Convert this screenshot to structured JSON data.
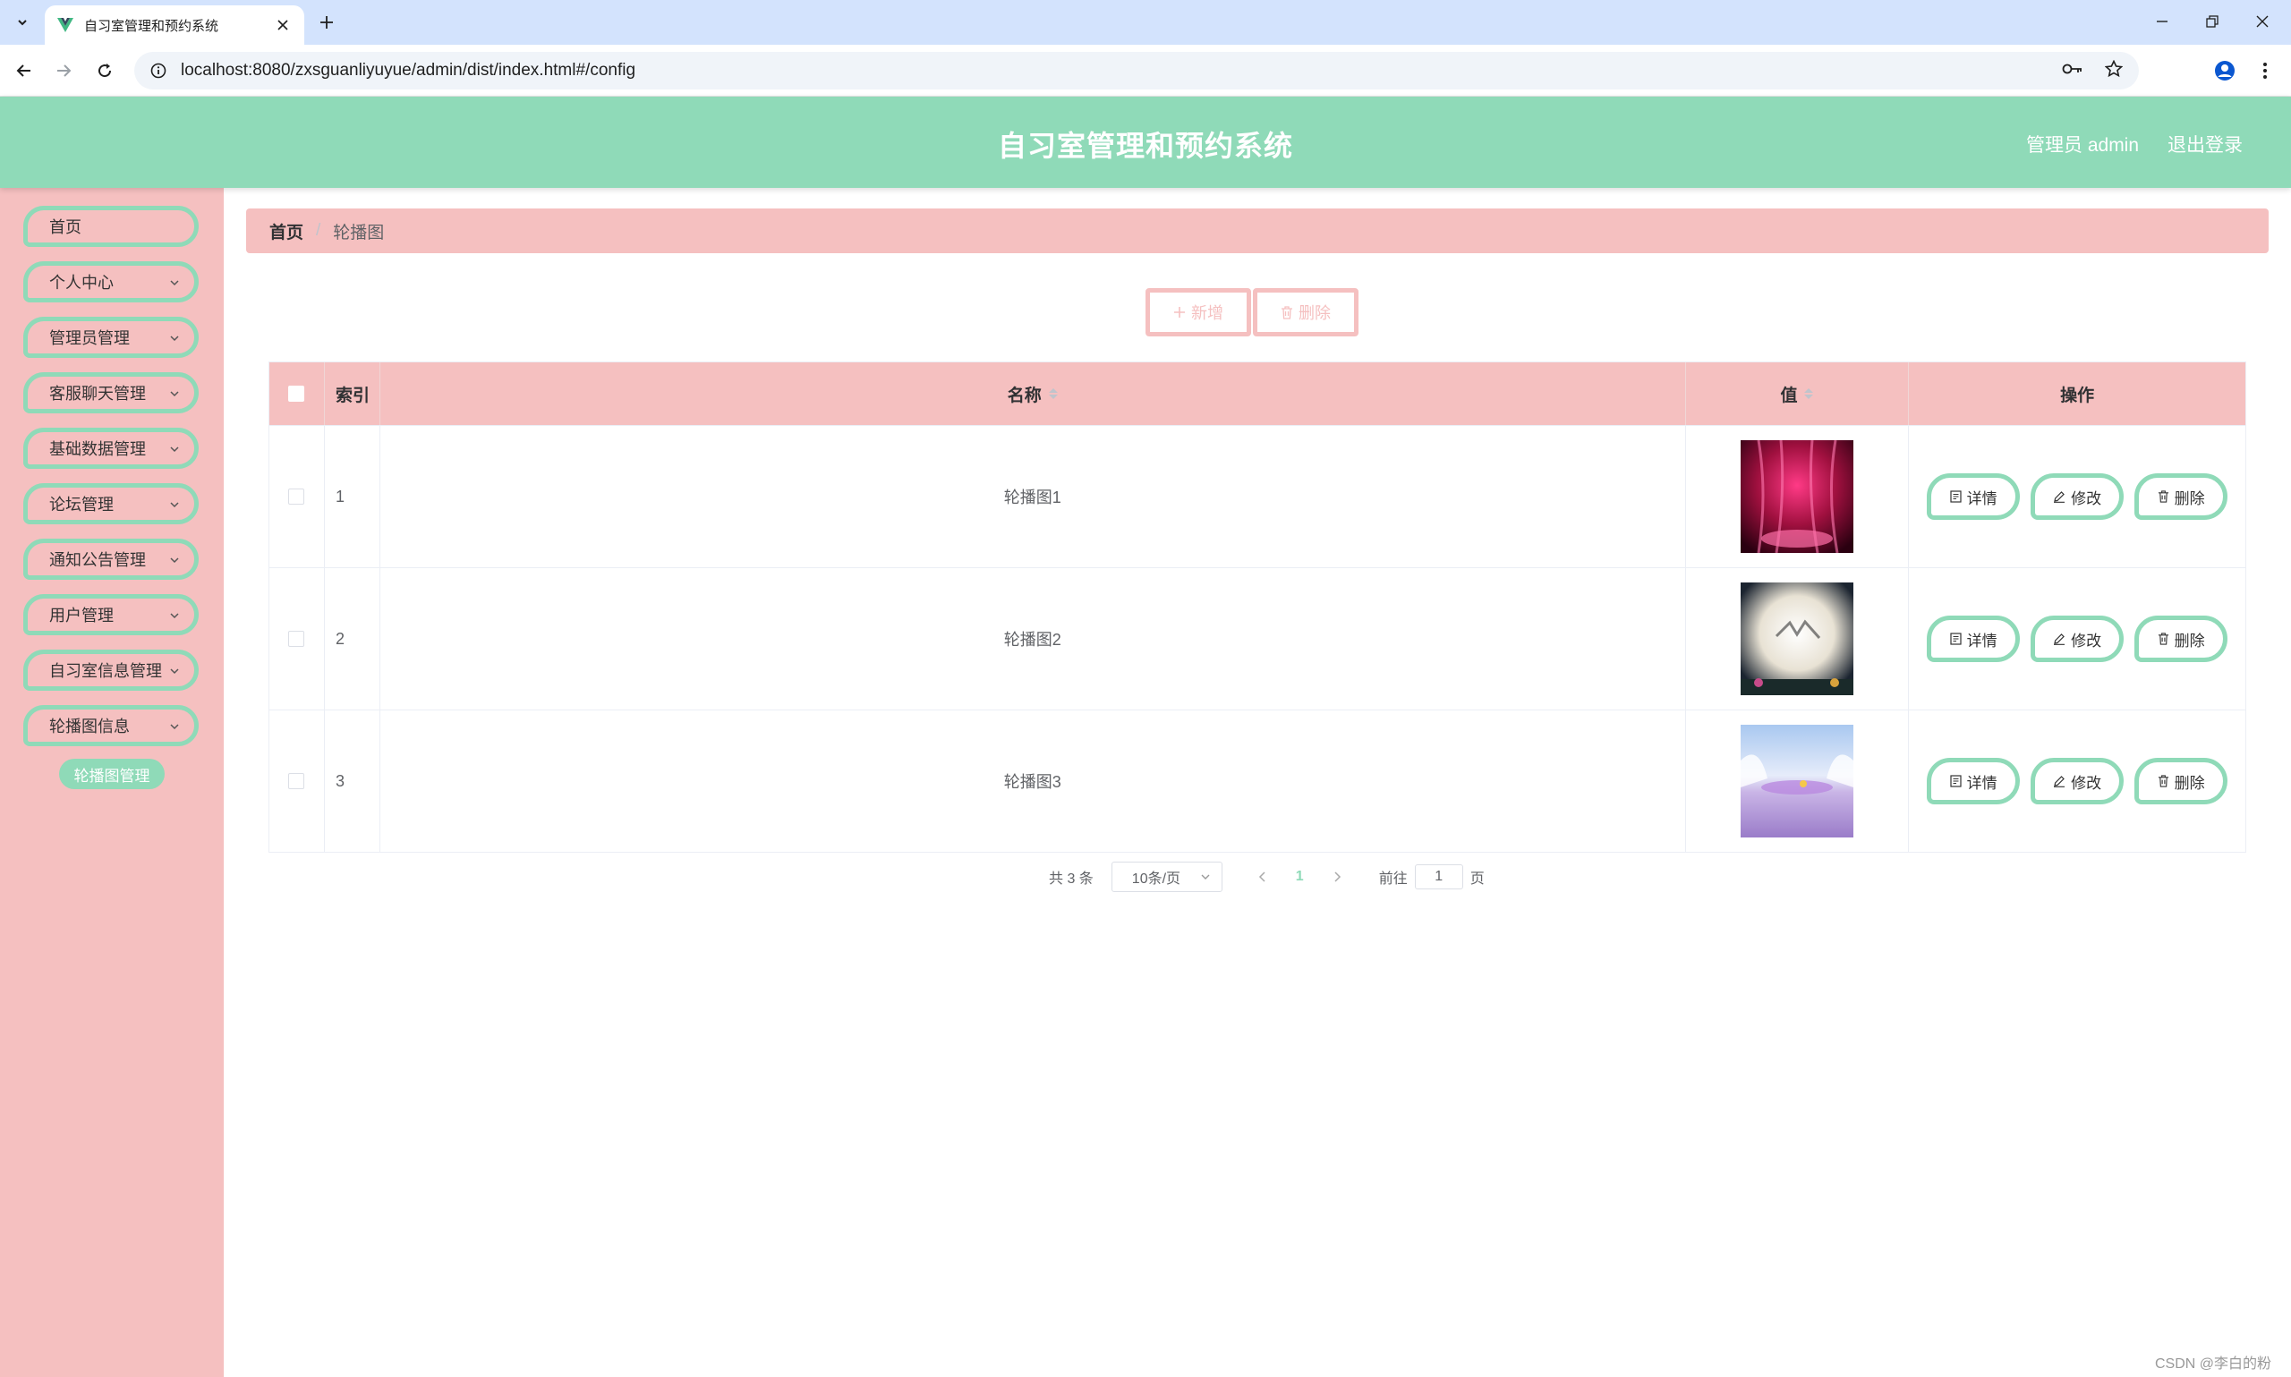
{
  "browser": {
    "tab_title": "自习室管理和预约系统",
    "url": "localhost:8080/zxsguanliyuyue/admin/dist/index.html#/config"
  },
  "header": {
    "title": "自习室管理和预约系统",
    "user": "管理员 admin",
    "logout": "退出登录"
  },
  "sidebar": {
    "items": [
      {
        "label": "首页"
      },
      {
        "label": "个人中心"
      },
      {
        "label": "管理员管理"
      },
      {
        "label": "客服聊天管理"
      },
      {
        "label": "基础数据管理"
      },
      {
        "label": "论坛管理"
      },
      {
        "label": "通知公告管理"
      },
      {
        "label": "用户管理"
      },
      {
        "label": "自习室信息管理"
      },
      {
        "label": "轮播图信息"
      }
    ],
    "submenu": {
      "label": "轮播图管理"
    }
  },
  "breadcrumb": {
    "home": "首页",
    "separator": "/",
    "current": "轮播图"
  },
  "toolbar": {
    "add_label": "新增",
    "delete_label": "删除"
  },
  "table": {
    "headers": {
      "index": "索引",
      "name": "名称",
      "value": "值",
      "actions": "操作"
    },
    "rows": [
      {
        "index": "1",
        "name": "轮播图1"
      },
      {
        "index": "2",
        "name": "轮播图2"
      },
      {
        "index": "3",
        "name": "轮播图3"
      }
    ],
    "actions": {
      "detail": "详情",
      "edit": "修改",
      "delete": "删除"
    }
  },
  "pagination": {
    "total": "共 3 条",
    "page_size": "10条/页",
    "current_page": "1",
    "goto_prefix": "前往",
    "goto_value": "1",
    "goto_suffix": "页"
  },
  "watermark": "CSDN @李白的粉",
  "colors": {
    "accent_green": "#8fdab8",
    "accent_pink": "#f5c0c0",
    "browser_tabbar": "#d3e3fd"
  }
}
